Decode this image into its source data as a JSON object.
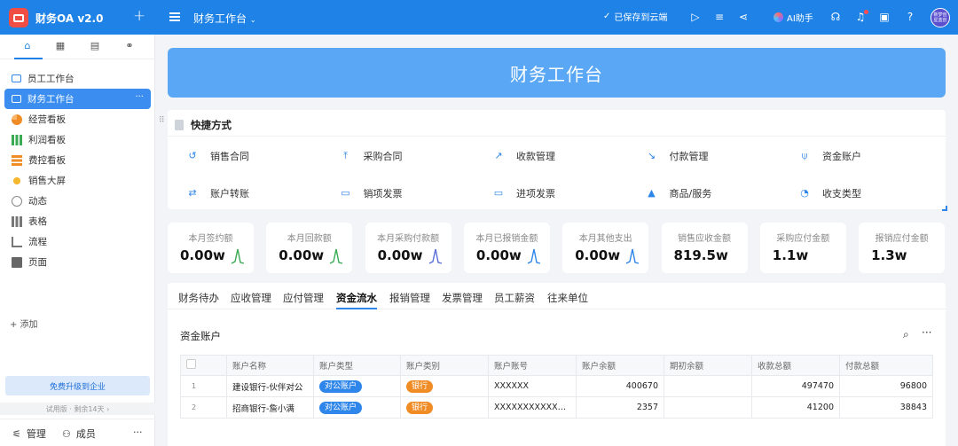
{
  "topbar": {
    "app_name": "财务OA v2.0",
    "page_title": "财务工作台",
    "saved_status": "已保存到云端",
    "ai_label": "AI助手",
    "avatar_text": "新梦创 星蓝创"
  },
  "colors": {
    "primary": "#1e82e6",
    "banner": "#5aa8f5",
    "badge_blue": "#2f86ea",
    "badge_orange": "#f08c25",
    "logo_red": "#f04e45"
  },
  "sidebar": {
    "items": [
      {
        "label": "员工工作台",
        "icon": "monitor-icon",
        "active": false
      },
      {
        "label": "财务工作台",
        "icon": "monitor-icon",
        "active": true
      },
      {
        "label": "经营看板",
        "icon": "pie-chart-icon",
        "active": false
      },
      {
        "label": "利润看板",
        "icon": "bar-chart-icon",
        "active": false
      },
      {
        "label": "费控看板",
        "icon": "bars-icon",
        "active": false
      },
      {
        "label": "销售大屏",
        "icon": "sun-icon",
        "active": false
      },
      {
        "label": "动态",
        "icon": "clock-icon",
        "active": false
      },
      {
        "label": "表格",
        "icon": "grid-icon",
        "active": false
      },
      {
        "label": "流程",
        "icon": "flow-icon",
        "active": false
      },
      {
        "label": "页面",
        "icon": "page-icon",
        "active": false
      }
    ],
    "add_label": "+ 添加",
    "upgrade_label": "免费升级到企业",
    "trial_label": "试用版 · 剩余14天",
    "manage_label": "管理",
    "members_label": "成员"
  },
  "banner": {
    "title": "财务工作台"
  },
  "quick": {
    "title": "快捷方式",
    "items": [
      {
        "label": "销售合同",
        "icon": "undo-icon"
      },
      {
        "label": "采购合同",
        "icon": "upload-icon"
      },
      {
        "label": "收款管理",
        "icon": "trend-up-icon"
      },
      {
        "label": "付款管理",
        "icon": "trend-down-icon"
      },
      {
        "label": "资金账户",
        "icon": "wallet-icon"
      },
      {
        "label": "账户转账",
        "icon": "transfer-icon"
      },
      {
        "label": "销项发票",
        "icon": "invoice-icon"
      },
      {
        "label": "进项发票",
        "icon": "invoice-icon"
      },
      {
        "label": "商品/服务",
        "icon": "goods-icon"
      },
      {
        "label": "收支类型",
        "icon": "pie-icon"
      }
    ]
  },
  "kpis": [
    {
      "label": "本月签约额",
      "value": "0.00w",
      "color": "#3aaa55"
    },
    {
      "label": "本月回款额",
      "value": "0.00w",
      "color": "#3aaa55"
    },
    {
      "label": "本月采购付款额",
      "value": "0.00w",
      "color": "#5b6fd8"
    },
    {
      "label": "本月已报销金额",
      "value": "0.00w",
      "color": "#2f86ea"
    },
    {
      "label": "本月其他支出",
      "value": "0.00w",
      "color": "#2f86ea"
    },
    {
      "label": "销售应收金额",
      "value": "819.5w"
    },
    {
      "label": "采购应付金额",
      "value": "1.1w"
    },
    {
      "label": "报销应付金额",
      "value": "1.3w"
    }
  ],
  "tabs": [
    "财务待办",
    "应收管理",
    "应付管理",
    "资金流水",
    "报销管理",
    "发票管理",
    "员工薪资",
    "往来单位"
  ],
  "active_tab": "资金流水",
  "table": {
    "title": "资金账户",
    "columns": [
      "账户名称",
      "账户类型",
      "账户类别",
      "账户账号",
      "账户余额",
      "期初余额",
      "收款总额",
      "付款总额"
    ],
    "rows": [
      {
        "index": "1",
        "name": "建设银行-伙伴对公",
        "type": "对公账户",
        "category": "银行",
        "account": "XXXXXX",
        "balance": "400670",
        "opening": "",
        "received": "497470",
        "paid": "96800"
      },
      {
        "index": "2",
        "name": "招商银行-詹小满",
        "type": "对公账户",
        "category": "银行",
        "account": "XXXXXXXXXXXXX...",
        "balance": "2357",
        "opening": "",
        "received": "41200",
        "paid": "38843"
      }
    ]
  }
}
